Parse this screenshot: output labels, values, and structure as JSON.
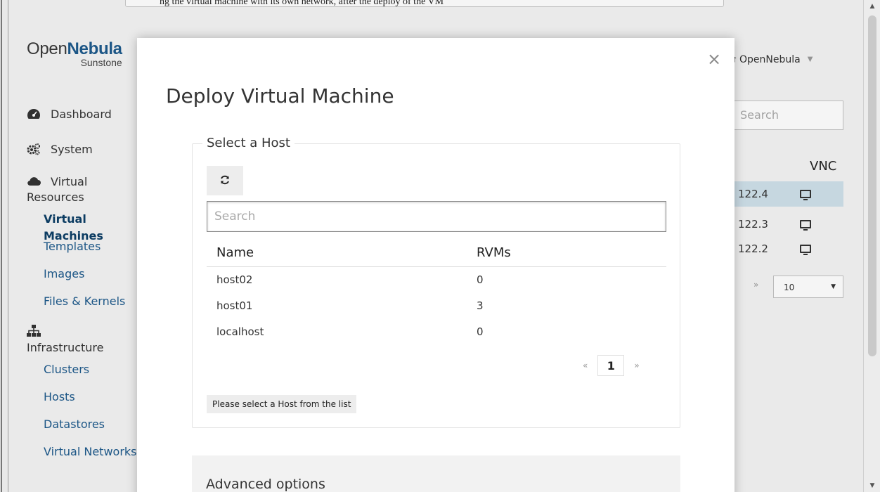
{
  "top_bar": {
    "text": "ng the virtual machine with its own network, after the deploy of the VM"
  },
  "sidebar": {
    "logo_main": "Open",
    "logo_bold": "Nebula",
    "logo_sub": "Sunstone",
    "items": [
      {
        "label": "Dashboard",
        "icon": "dashboard-icon"
      },
      {
        "label": "System",
        "icon": "cogs-icon"
      }
    ],
    "virtual": {
      "label_line1": "Virtual",
      "label_line2": "Resources",
      "icon": "cloud-icon"
    },
    "virtual_sub": [
      "Virtual Machines",
      "Templates",
      "Images",
      "Files & Kernels"
    ],
    "infra": {
      "label": "Infrastructure",
      "icon": "sitemap-icon"
    },
    "infra_sub": [
      "Clusters",
      "Hosts",
      "Datastores",
      "Virtual Networks"
    ]
  },
  "right_panel": {
    "owner": "OpenNebula",
    "search_placeholder": "Search",
    "vnc_header": "VNC",
    "rows": [
      "122.4",
      "122.3",
      "122.2"
    ],
    "pager_next": "»",
    "page_size": "10"
  },
  "modal": {
    "title": "Deploy Virtual Machine",
    "close": "×",
    "host_section": {
      "legend": "Select a Host",
      "search_placeholder": "Search",
      "columns": [
        "Name",
        "RVMs"
      ],
      "rows": [
        {
          "name": "host02",
          "rvms": "0"
        },
        {
          "name": "host01",
          "rvms": "3"
        },
        {
          "name": "localhost",
          "rvms": "0"
        }
      ],
      "pager": {
        "prev": "«",
        "page": "1",
        "next": "»"
      },
      "hint": "Please select a Host from the list"
    },
    "advanced_label": "Advanced options"
  }
}
